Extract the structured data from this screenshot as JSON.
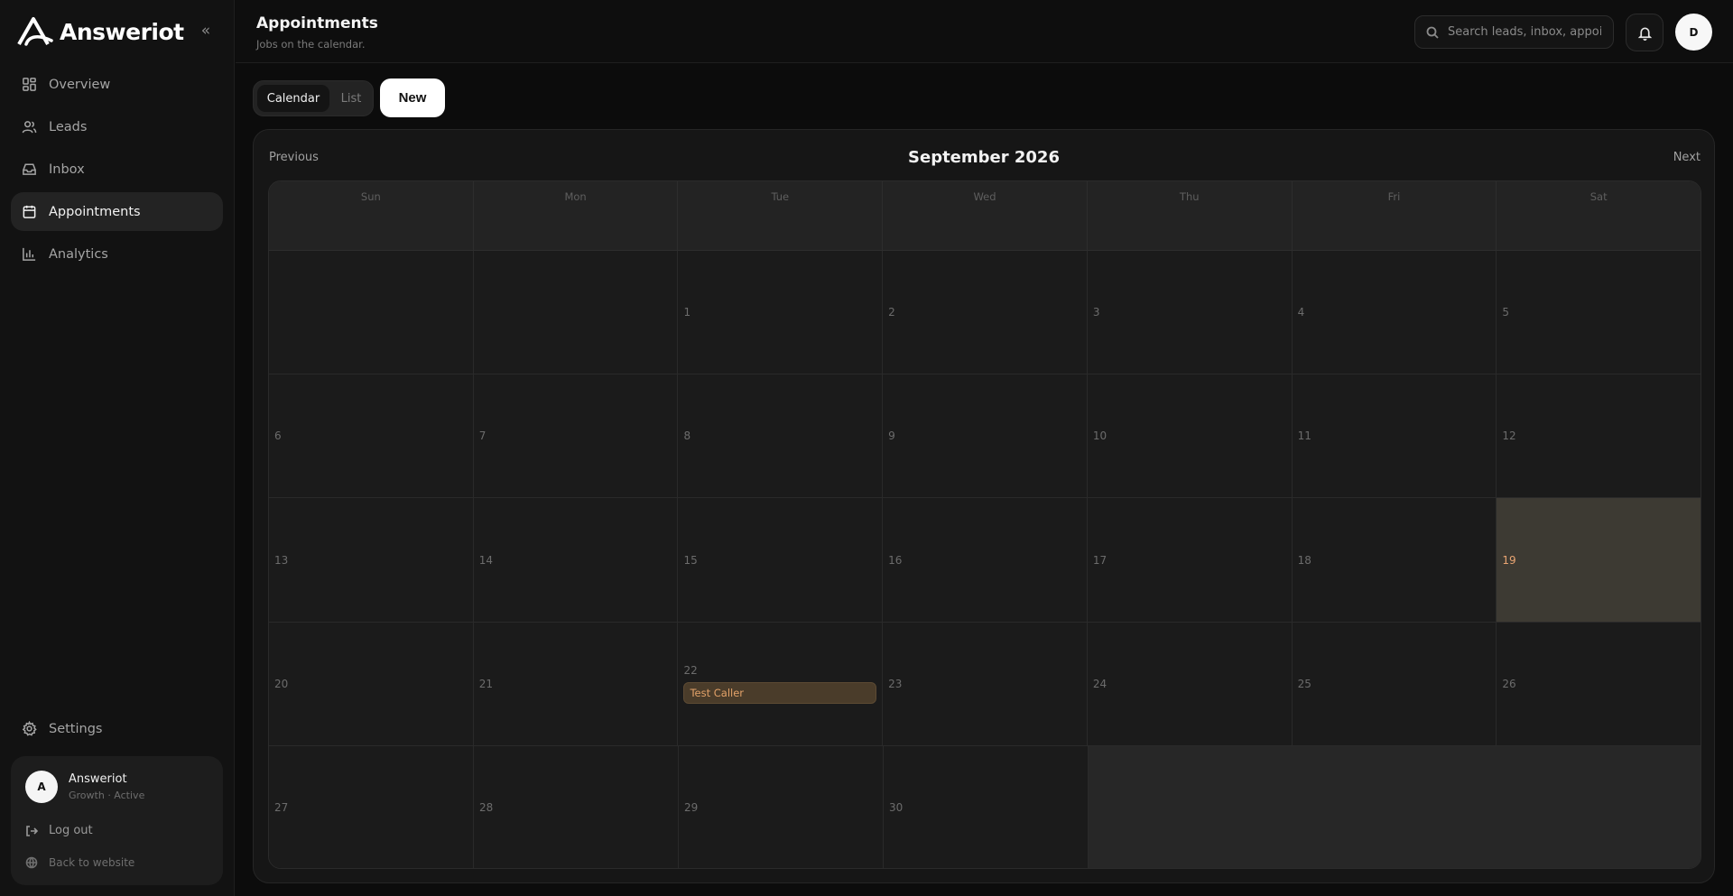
{
  "app": {
    "name": "Answeriot",
    "collapse_icon": "«"
  },
  "sidebar": {
    "items": [
      {
        "label": "Overview",
        "icon": "grid-icon"
      },
      {
        "label": "Leads",
        "icon": "users-icon"
      },
      {
        "label": "Inbox",
        "icon": "inbox-icon"
      },
      {
        "label": "Appointments",
        "icon": "calendar-icon",
        "active": true
      },
      {
        "label": "Analytics",
        "icon": "bar-chart-icon"
      }
    ],
    "settings_label": "Settings",
    "account": {
      "avatar_initial": "A",
      "name": "Answeriot",
      "plan": "Growth · Active",
      "logout_label": "Log out",
      "back_label": "Back to website"
    }
  },
  "header": {
    "title": "Appointments",
    "subtitle": "Jobs on the calendar.",
    "search_placeholder": "Search leads, inbox, appoin",
    "user_initial": "D"
  },
  "toolbar": {
    "calendar_label": "Calendar",
    "list_label": "List",
    "new_label": "New"
  },
  "calendar": {
    "prev_label": "Previous",
    "next_label": "Next",
    "month_label": "September 2026",
    "weekdays": [
      "Sun",
      "Mon",
      "Tue",
      "Wed",
      "Thu",
      "Fri",
      "Sat"
    ],
    "weeks": [
      [
        "",
        "",
        "1",
        "2",
        "3",
        "4",
        "5"
      ],
      [
        "6",
        "7",
        "8",
        "9",
        "10",
        "11",
        "12"
      ],
      [
        "13",
        "14",
        "15",
        "16",
        "17",
        "18",
        "19"
      ],
      [
        "20",
        "21",
        "22",
        "23",
        "24",
        "25",
        "26"
      ],
      [
        "27",
        "28",
        "29",
        "30"
      ]
    ],
    "today": "19",
    "events": [
      {
        "day": "22",
        "title": "Test Caller"
      }
    ]
  },
  "colors": {
    "accent": "#e8a472",
    "today_bg": "#3d3a33",
    "event_bg": "#4a3c2a"
  }
}
